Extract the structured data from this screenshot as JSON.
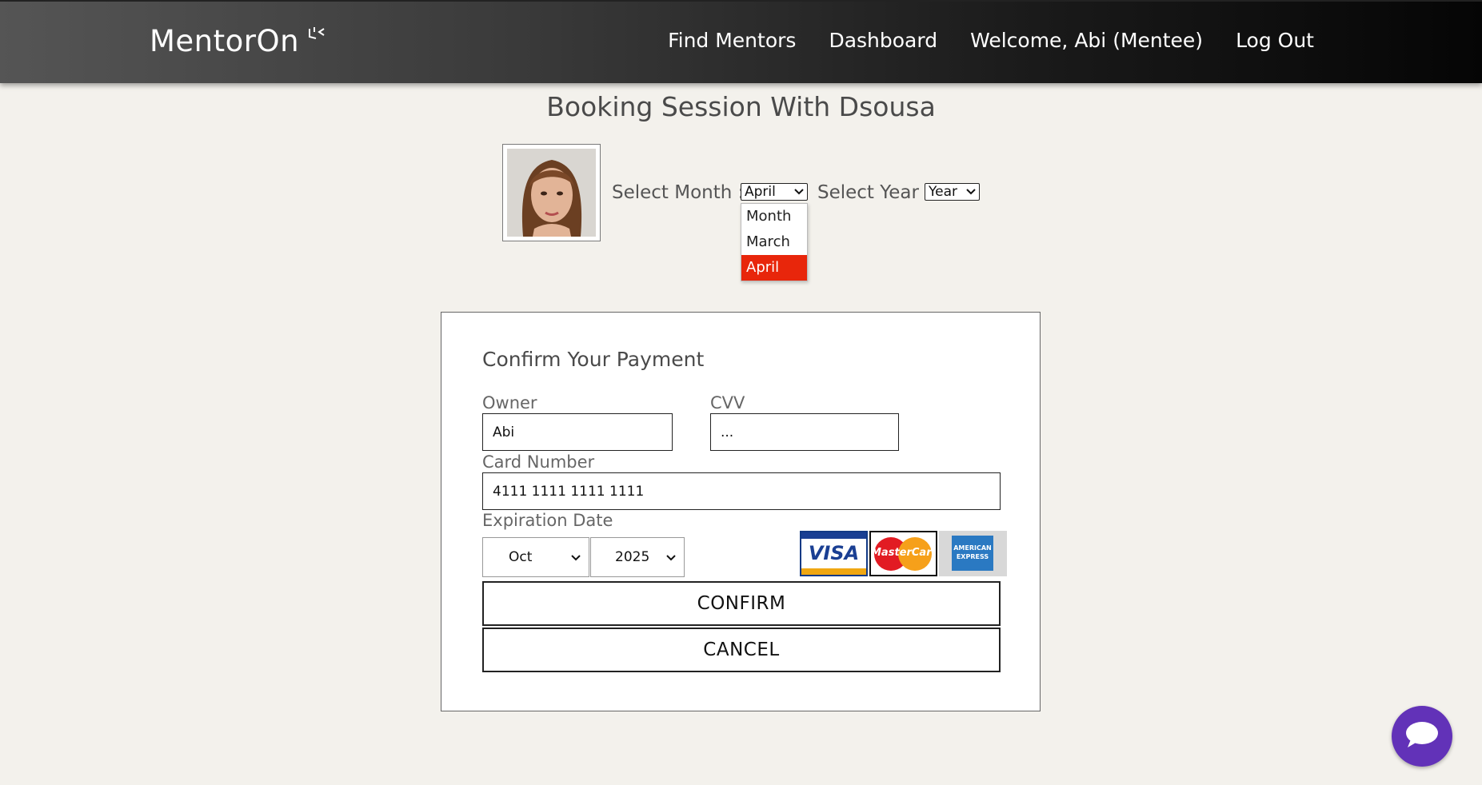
{
  "header": {
    "logo_text": "MentorOn",
    "nav": {
      "find_mentors": "Find Mentors",
      "dashboard": "Dashboard",
      "welcome": "Welcome, Abi (Mentee)",
      "logout": "Log Out"
    }
  },
  "page": {
    "title": "Booking Session With Dsousa"
  },
  "booking": {
    "month_label": "Select Month :",
    "month_value": "April",
    "month_options": [
      "Month",
      "March",
      "April"
    ],
    "year_label": "Select Year :",
    "year_value": "Year"
  },
  "payment": {
    "title": "Confirm Your Payment",
    "owner_label": "Owner",
    "owner_value": "Abi",
    "cvv_label": "CVV",
    "cvv_value": "...",
    "card_number_label": "Card Number",
    "card_number_value": "4111 1111 1111 1111",
    "expiration_label": "Expiration Date",
    "exp_month": "Oct",
    "exp_year": "2025",
    "card_logos": {
      "visa": "VISA",
      "mastercard": "MasterCard",
      "amex": "AMERICAN EXPRESS"
    },
    "confirm_label": "CONFIRM",
    "cancel_label": "CANCEL"
  },
  "colors": {
    "accent_selected": "#e8260b",
    "chat_button": "#6232b8",
    "background": "#f3f1ec"
  }
}
